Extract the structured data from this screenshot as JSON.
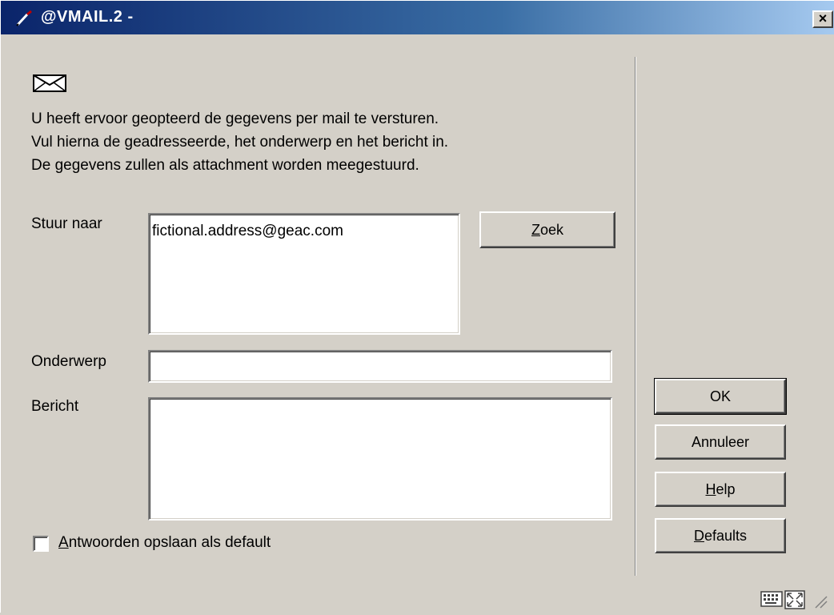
{
  "window": {
    "title": "@VMAIL.2 -",
    "close_glyph": "×"
  },
  "intro": {
    "lines": [
      "U heeft ervoor geopteerd de gegevens per mail te versturen.",
      "Vul hierna de geadresseerde, het onderwerp en het bericht in.",
      "De gegevens zullen als attachment worden meegestuurd."
    ]
  },
  "form": {
    "to_label": "Stuur naar",
    "to_value": "fictional.address@geac.com",
    "subject_label": "Onderwerp",
    "subject_value": "",
    "message_label": "Bericht",
    "message_value": "",
    "save_defaults_label": "Antwoorden opslaan als default",
    "save_defaults_checked": false
  },
  "buttons": {
    "search": {
      "mnemonic": "Z",
      "rest": "oek"
    },
    "ok": "OK",
    "cancel": "Annuleer",
    "help": {
      "mnemonic": "H",
      "rest": "elp"
    },
    "defaults": {
      "mnemonic": "D",
      "rest": "efaults"
    }
  },
  "icons": {
    "title": "pen-icon",
    "mail": "envelope-icon",
    "status_left": "keyboard-icon",
    "status_right": "resize-icon"
  },
  "colors": {
    "title_start": "#0a246a",
    "title_end": "#a6caf0",
    "face": "#d4d0c8"
  }
}
